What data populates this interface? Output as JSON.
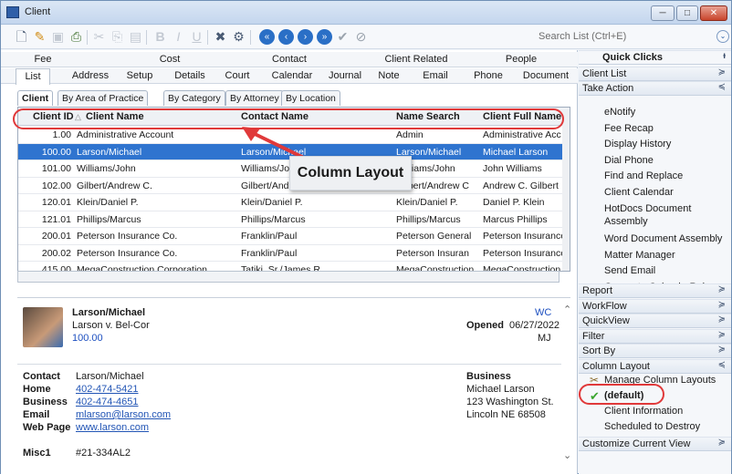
{
  "window": {
    "title": "Client",
    "min": "─",
    "max": "□",
    "close": "✕"
  },
  "toolbar": {
    "search_placeholder": "Search List (Ctrl+E)",
    "search_btn": "⌄"
  },
  "toptabs": [
    {
      "label": "Fee"
    },
    {
      "label": "Cost"
    },
    {
      "label": "Contact"
    },
    {
      "label": "Client Related"
    },
    {
      "label": "People"
    }
  ],
  "bottomtabs": [
    {
      "label": "List"
    },
    {
      "label": "Address"
    },
    {
      "label": "Setup"
    },
    {
      "label": "Details"
    },
    {
      "label": "Court"
    },
    {
      "label": "Calendar"
    },
    {
      "label": "Journal"
    },
    {
      "label": "Note"
    },
    {
      "label": "Email"
    },
    {
      "label": "Phone"
    },
    {
      "label": "Document"
    }
  ],
  "subtabs": [
    {
      "label": "Client"
    },
    {
      "label": "By Area of Practice"
    },
    {
      "label": "By Category"
    },
    {
      "label": "By Attorney"
    },
    {
      "label": "By Location"
    }
  ],
  "grid": {
    "headers": [
      "Client ID",
      "Client Name",
      "Contact Name",
      "Name Search",
      "Client Full Name"
    ],
    "rows": [
      [
        "1.00",
        "Administrative Account",
        "",
        "Admin",
        "Administrative Acc"
      ],
      [
        "100.00",
        "Larson/Michael",
        "Larson/Michael",
        "Larson/Michael",
        "Michael Larson"
      ],
      [
        "101.00",
        "Williams/John",
        "Williams/John",
        "Williams/John",
        "John Williams"
      ],
      [
        "102.00",
        "Gilbert/Andrew C.",
        "Gilbert/Andrew C.",
        "Gilbert/Andrew C",
        "Andrew C. Gilbert"
      ],
      [
        "120.01",
        "Klein/Daniel P.",
        "Klein/Daniel P.",
        "Klein/Daniel P.",
        "Daniel P. Klein"
      ],
      [
        "121.01",
        "Phillips/Marcus",
        "Phillips/Marcus",
        "Phillips/Marcus",
        "Marcus Phillips"
      ],
      [
        "200.01",
        "Peterson Insurance Co.",
        "Franklin/Paul",
        "Peterson General",
        "Peterson Insurance"
      ],
      [
        "200.02",
        "Peterson Insurance Co.",
        "Franklin/Paul",
        "Peterson Insuran",
        "Peterson Insurance"
      ],
      [
        "415.00",
        "MegaConstruction Corporation",
        "Tatiki, Sr./James R.",
        "MegaConstruction",
        "MegaConstruction"
      ]
    ],
    "selected_index": 1
  },
  "callout": "Column Layout",
  "detail": {
    "name": "Larson/Michael",
    "matter": "Larson v. Bel-Cor",
    "id": "100.00",
    "code": "WC",
    "opened_label": "Opened",
    "opened": "06/27/2022",
    "initials": "MJ",
    "contact_label": "Contact",
    "contact": "Larson/Michael",
    "home_label": "Home",
    "home": "402-474-5421",
    "business_label": "Business",
    "business": "402-474-4651",
    "email_label": "Email",
    "email": "mlarson@larson.com",
    "web_label": "Web Page",
    "web": "www.larson.com",
    "biz_heading": "Business",
    "biz_name": "Michael Larson",
    "biz_street": "123 Washington St.",
    "biz_city": "Lincoln  NE  68508",
    "misc_label": "Misc1",
    "misc": "#21-334AL2"
  },
  "sidebar": {
    "quick_clicks": "Quick Clicks",
    "pin": "ᵻ",
    "client_list": "Client List",
    "take_action": "Take Action",
    "actions": [
      "eNotify",
      "Fee Recap",
      "Display History",
      "Dial Phone",
      "Find and Replace",
      "Client Calendar",
      "HotDocs Document",
      "Assembly",
      "Word Document Assembly",
      "Matter Manager",
      "Send Email",
      "Generate CalendarRules"
    ],
    "sections": [
      "Report",
      "WorkFlow",
      "QuickView",
      "Filter",
      "Sort By",
      "Column Layout"
    ],
    "layout_items": {
      "manage": "Manage Column Layouts",
      "default": "(default)",
      "client_info": "Client Information",
      "scheduled": "Scheduled to Destroy"
    },
    "customize": "Customize Current View"
  }
}
